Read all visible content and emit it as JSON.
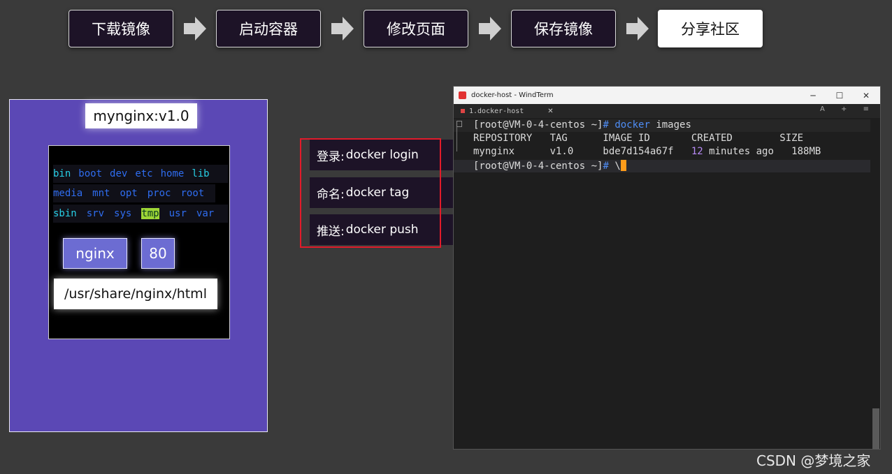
{
  "steps": [
    {
      "label": "下载镜像",
      "active": false
    },
    {
      "label": "启动容器",
      "active": false
    },
    {
      "label": "修改页面",
      "active": false
    },
    {
      "label": "保存镜像",
      "active": false
    },
    {
      "label": "分享社区",
      "active": true
    }
  ],
  "image_card": {
    "title": "mynginx:v1.0",
    "dirs_row1": [
      "bin",
      "boot",
      "dev",
      "etc",
      "home",
      "lib"
    ],
    "dirs_row2": [
      "media",
      "mnt",
      "opt",
      "proc",
      "root"
    ],
    "dirs_row3": [
      "sbin",
      "srv",
      "sys",
      "tmp",
      "usr",
      "var"
    ],
    "app": "nginx",
    "port": "80",
    "path": "/usr/share/nginx/html"
  },
  "commands": [
    {
      "label": "登录:",
      "cmd": "docker login"
    },
    {
      "label": "命名:",
      "cmd": "docker tag"
    },
    {
      "label": "推送:",
      "cmd": "docker push"
    }
  ],
  "terminal": {
    "window_title": "docker-host - WindTerm",
    "tab_label": "1.docker-host",
    "minimize": "─",
    "maximize": "☐",
    "close": "✕",
    "tab_close": "✕",
    "tab_tools": "A + ≡",
    "prompt": "[root@VM-0-4-centos ~]",
    "prompt_hash": "#",
    "cmd_word": "docker",
    "cmd_arg": "images",
    "header": "REPOSITORY   TAG      IMAGE ID       CREATED        SIZE",
    "row_repo": "mynginx      v1.0     bde7d154a67f   ",
    "row_num": "12",
    "row_rest": " minutes ago   188MB",
    "prompt2_tail": "\\"
  },
  "watermark": "CSDN @梦境之家",
  "colors": {
    "accent_red": "#e21b2a",
    "card_purple": "#5b48b5",
    "cursor": "#ff9c1a"
  }
}
